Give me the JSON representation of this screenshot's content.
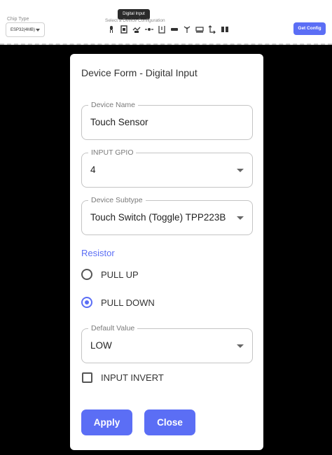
{
  "toolbar": {
    "chip_type_label": "Chip Type",
    "chip_value": "ESP32(4MB)",
    "tooltip": "Digital Input",
    "select_config_label": "Select a Device Configuration",
    "get_config_label": "Get Config",
    "icons": [
      "led-icon",
      "digital-input-icon",
      "relay-icon",
      "dimmer-icon",
      "switch-icon",
      "sensor-icon",
      "antenna-icon",
      "display-icon",
      "pwm-icon",
      "motor-icon"
    ]
  },
  "dialog": {
    "title": "Device Form - Digital Input",
    "device_name": {
      "label": "Device Name",
      "value": "Touch Sensor"
    },
    "input_gpio": {
      "label": "INPUT GPIO",
      "value": "4"
    },
    "device_subtype": {
      "label": "Device Subtype",
      "value": "Touch Switch (Toggle) TPP223B"
    },
    "resistor_label": "Resistor",
    "pull_up": "PULL UP",
    "pull_down": "PULL DOWN",
    "selected_resistor": "PULL DOWN",
    "default_value": {
      "label": "Default Value",
      "value": "LOW"
    },
    "input_invert": "INPUT INVERT",
    "apply": "Apply",
    "close": "Close"
  },
  "colors": {
    "accent": "#5b6ef5",
    "backdrop": "#000000"
  }
}
